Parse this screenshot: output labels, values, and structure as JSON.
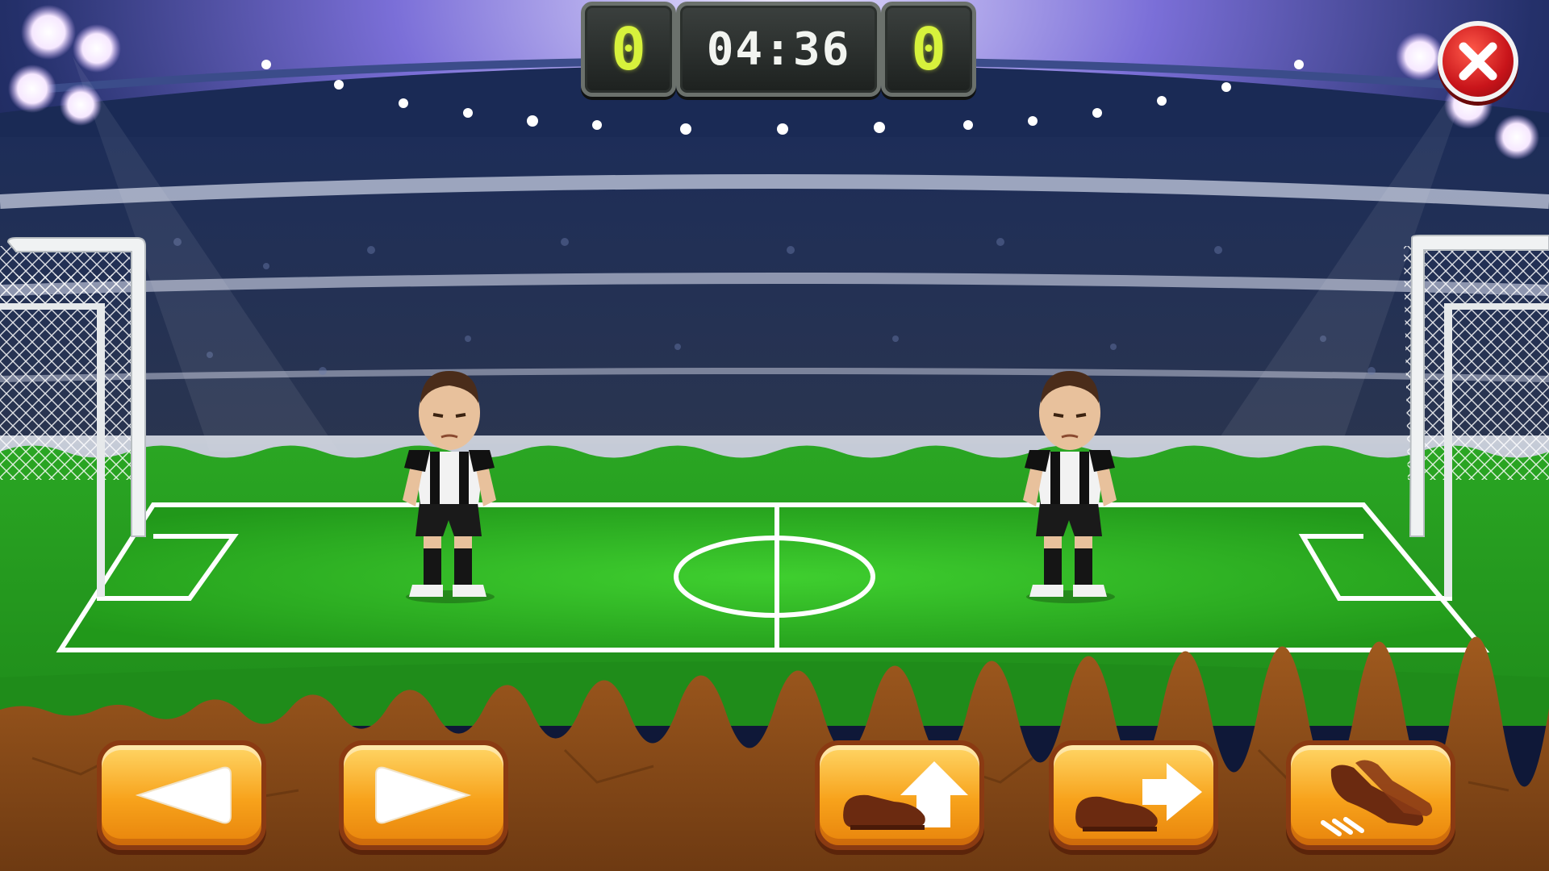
{
  "scoreboard": {
    "home_score": "0",
    "away_score": "0",
    "time": "04:36"
  },
  "controls": {
    "move_left": "arrow-left-icon",
    "move_right": "arrow-right-icon",
    "jump": "boot-jump-icon",
    "kick": "boot-kick-icon",
    "power_shot": "boots-power-icon",
    "close": "close-icon"
  },
  "colors": {
    "pitch": "#2fb52a",
    "button_orange": "#f7a21b",
    "button_border": "#8a3a12",
    "close_red": "#c8141a",
    "digit_green": "#d7f23c"
  }
}
